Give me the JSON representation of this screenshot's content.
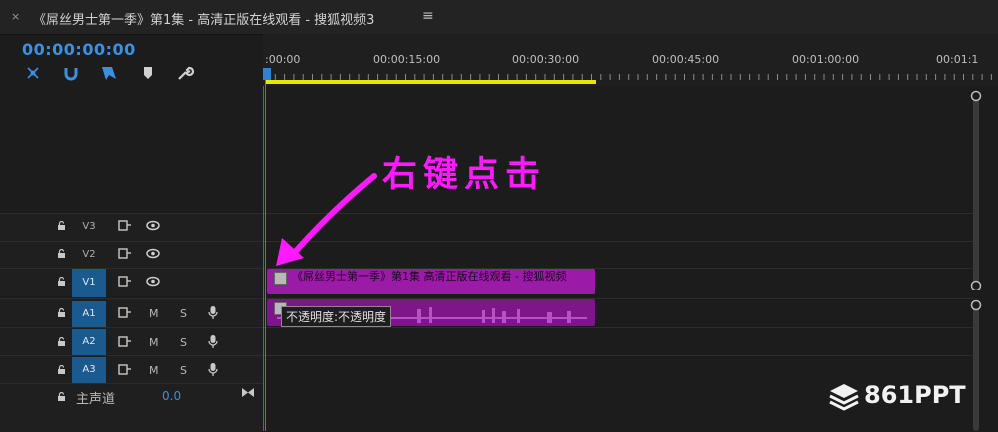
{
  "title_bar": {
    "close": "×",
    "sequence_title": "《屌丝男士第一季》第1集 - 高清正版在线观看 - 搜狐视频3",
    "menu": "≡"
  },
  "timecode": "00:00:00:00",
  "toolbar": {
    "icons": [
      "snap-icon",
      "magnet-link-icon",
      "add-marker-icon",
      "marker-icon",
      "wrench-icon"
    ]
  },
  "ruler": {
    "labels": [
      ":00:00",
      "00:00:15:00",
      "00:00:30:00",
      "00:00:45:00",
      "00:01:00:00",
      "00:01:1"
    ]
  },
  "video_tracks": [
    {
      "name": "V3",
      "selected": false
    },
    {
      "name": "V2",
      "selected": false
    },
    {
      "name": "V1",
      "selected": true
    }
  ],
  "audio_tracks": [
    {
      "name": "A1",
      "selected": true,
      "m": "M",
      "s": "S"
    },
    {
      "name": "A2",
      "selected": true,
      "m": "M",
      "s": "S"
    },
    {
      "name": "A3",
      "selected": true,
      "m": "M",
      "s": "S"
    }
  ],
  "master": {
    "label": "主声道",
    "value": "0.0"
  },
  "clip_v1_label": "《屌丝男士第一季》第1集 高清正版在线观看 - 搜狐视频",
  "tooltip": "不透明度:不透明度",
  "annotation": "右键点击",
  "watermark": "861PPT",
  "colors": {
    "clip": "#9c1aa8",
    "annotation": "#ff1aff",
    "accent": "#2d84d6",
    "work_area": "#e6e600"
  }
}
